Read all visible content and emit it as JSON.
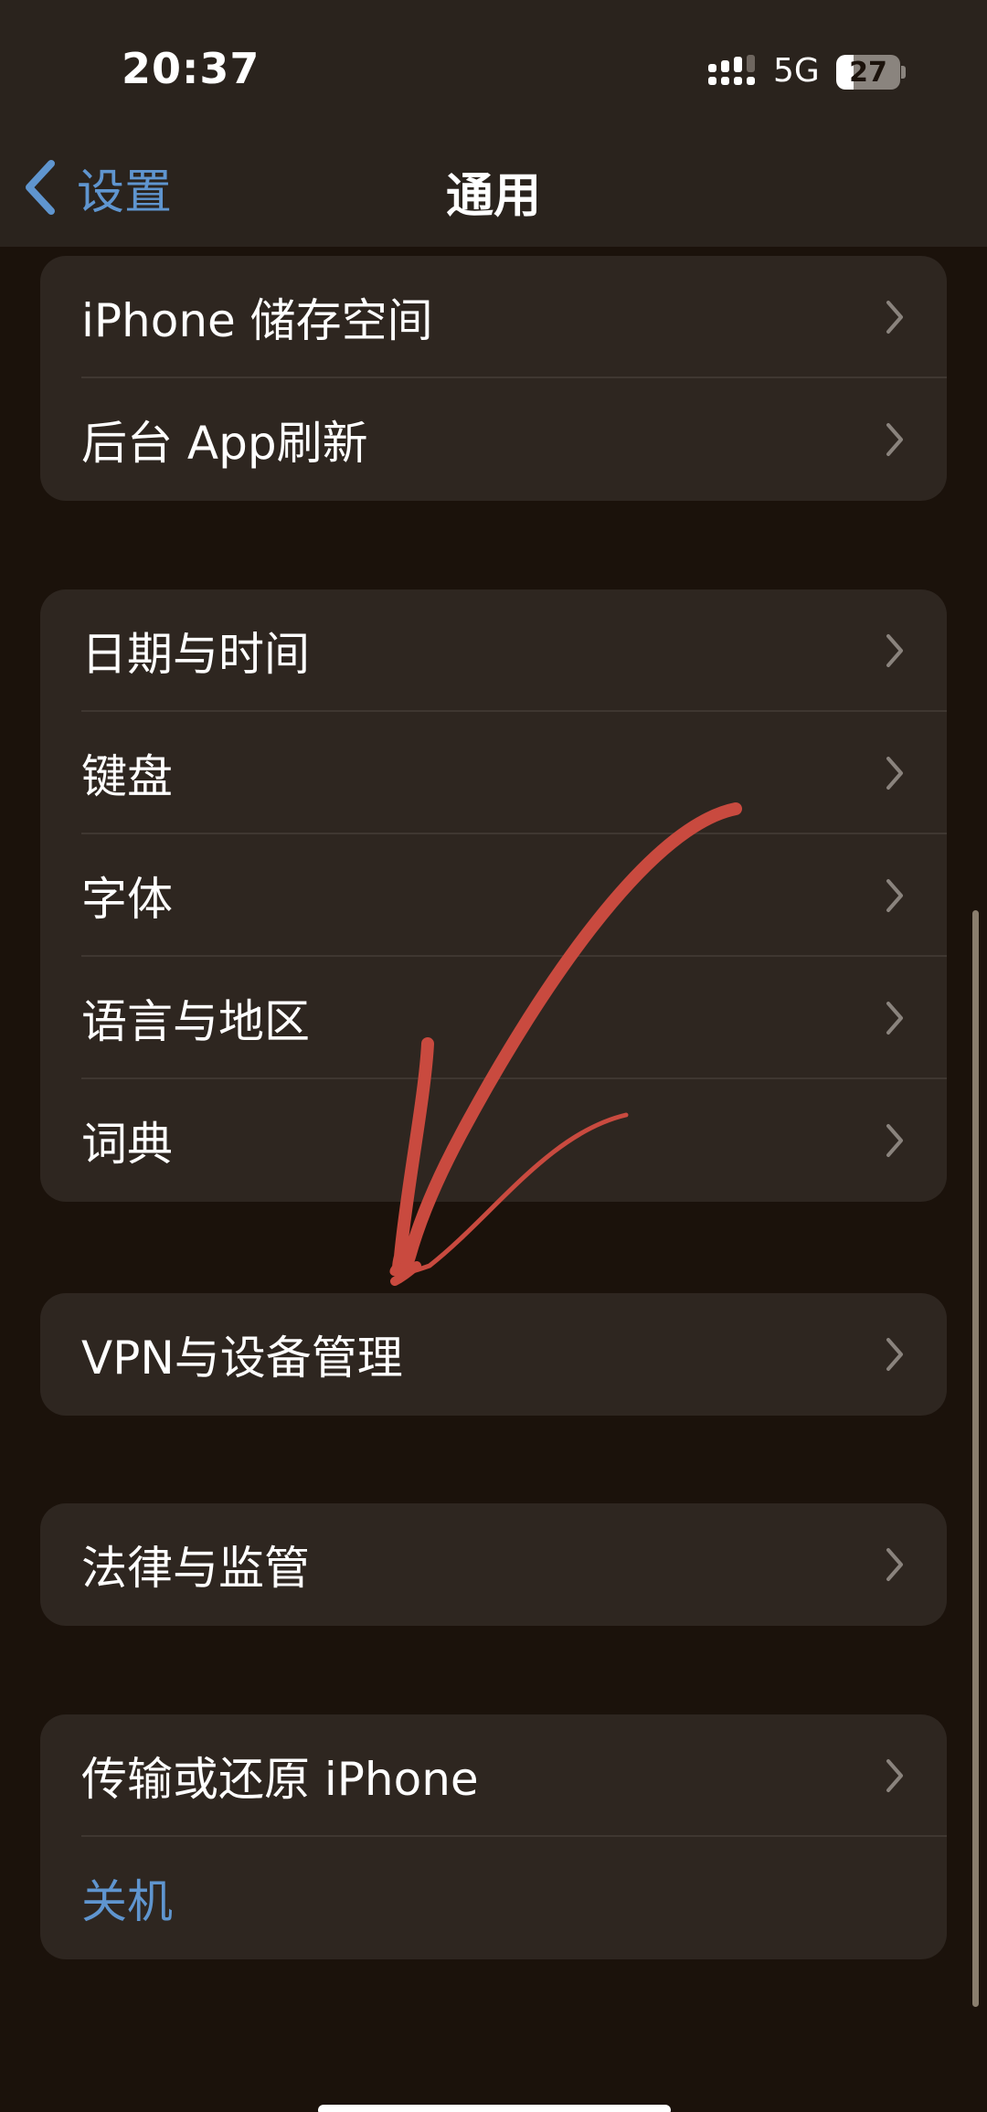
{
  "status_bar": {
    "time": "20:37",
    "network": "5G",
    "battery": "27",
    "battery_level": 0.27,
    "signal_icon": "cellular-signal-icon"
  },
  "nav": {
    "back_label": "设置",
    "title": "通用"
  },
  "groups": [
    {
      "items": [
        {
          "label": "iPhone 储存空间"
        },
        {
          "label": "后台 App刷新"
        }
      ]
    },
    {
      "items": [
        {
          "label": "日期与时间"
        },
        {
          "label": "键盘"
        },
        {
          "label": "字体"
        },
        {
          "label": "语言与地区"
        },
        {
          "label": "词典"
        }
      ]
    },
    {
      "items": [
        {
          "label": "VPN与设备管理"
        }
      ]
    },
    {
      "items": [
        {
          "label": "法律与监管"
        }
      ]
    },
    {
      "items": [
        {
          "label": "传输或还原 iPhone"
        },
        {
          "label": "关机"
        }
      ]
    }
  ],
  "colors": {
    "accent": "#5f95cf",
    "background": "#1b120b",
    "cell": "#2e2620",
    "annotation": "#c94a3f"
  }
}
